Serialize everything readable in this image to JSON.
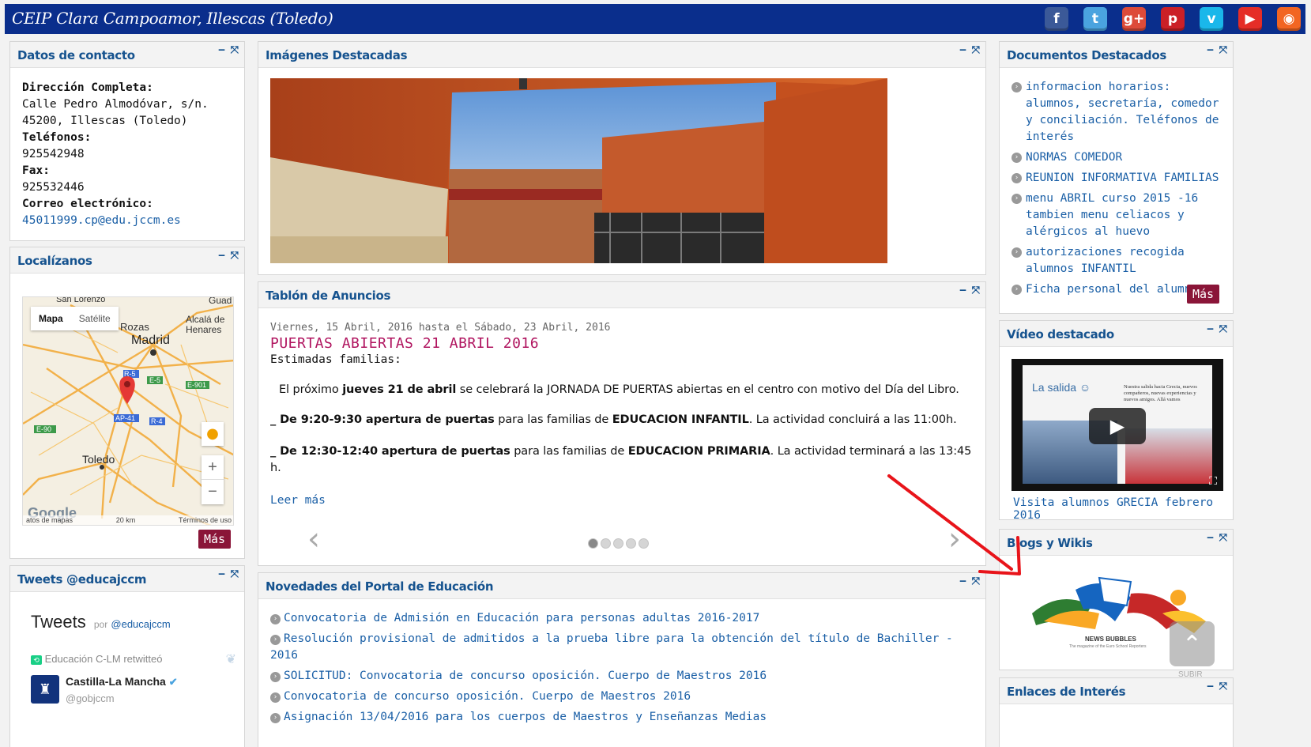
{
  "site_title": "CEIP Clara Campoamor, Illescas (Toledo)",
  "social": [
    {
      "icon": "facebook-icon",
      "glyph": "f",
      "color": "#3b5998"
    },
    {
      "icon": "twitter-icon",
      "glyph": "t",
      "color": "#4aa3df"
    },
    {
      "icon": "googleplus-icon",
      "glyph": "g+",
      "color": "#dd4b39"
    },
    {
      "icon": "pinterest-icon",
      "glyph": "p",
      "color": "#cb2027"
    },
    {
      "icon": "vimeo-icon",
      "glyph": "v",
      "color": "#1ab7ea"
    },
    {
      "icon": "youtube-icon",
      "glyph": "▶",
      "color": "#e52d27"
    },
    {
      "icon": "rss-icon",
      "glyph": "◉",
      "color": "#f26522"
    }
  ],
  "contact": {
    "title": "Datos de contacto",
    "address_label": "Dirección Completa:",
    "address": "Calle Pedro Almodóvar, s/n. 45200, Illescas (Toledo)",
    "phones_label": "Teléfonos:",
    "phone": "925542948",
    "fax_label": "Fax:",
    "fax": "925532446",
    "email_label": "Correo electrónico:",
    "email": "45011999.cp@edu.jccm.es"
  },
  "map": {
    "title": "Localízanos",
    "tab_map": "Mapa",
    "tab_satellite": "Satélite",
    "labels": {
      "madrid": "Madrid",
      "toledo": "Toledo",
      "rozas": "Rozas",
      "alcala": "Alcalá de Henares",
      "sanlorenzo": "San Lorenzo",
      "guad": "Guad"
    },
    "roads": {
      "r5": "R-5",
      "e5": "E-5",
      "e901": "E-901",
      "e90": "E-90",
      "ap41": "AP-41",
      "r4": "R-4"
    },
    "footer_data": "atos de mapas",
    "scale": "20 km",
    "terms": "Términos de uso",
    "google": "Google",
    "zoom_in": "+",
    "zoom_out": "−",
    "more": "Más"
  },
  "tweets": {
    "title": "Tweets @educajccm",
    "heading": "Tweets",
    "by": "por",
    "handle_link": "@educajccm",
    "retweet": "Educación C-LM retwitteó",
    "author": "Castilla-La Mancha",
    "author_handle": "@gobjccm"
  },
  "images": {
    "title": "Imágenes Destacadas"
  },
  "board": {
    "title": "Tablón de Anuncios",
    "date": "Viernes, 15 Abril, 2016 hasta el Sábado, 23 Abril, 2016",
    "headline": "PUERTAS ABIERTAS 21 ABRIL 2016",
    "greeting": "Estimadas familias:",
    "p1_a": "El próximo ",
    "p1_b": "jueves 21 de abril",
    "p1_c": " se celebrará la JORNADA DE PUERTAS abiertas en el centro con motivo del Día del Libro.",
    "p2_a": "_ De 9:20-9:30 apertura de puertas",
    "p2_b": " para las familias de ",
    "p2_c": "EDUCACION INFANTIL",
    "p2_d": ". La actividad concluirá a las 11:00h.",
    "p3_a": "_ De 12:30-12:40 apertura de puertas",
    "p3_b": "  para las familias de ",
    "p3_c": "EDUCACION PRIMARIA",
    "p3_d": ". La actividad terminará a las 13:45 h.",
    "read_more": "Leer más",
    "prev": "‹",
    "next": "›"
  },
  "news": {
    "title": "Novedades del Portal de Educación",
    "items": [
      "Convocatoria de Admisión en Educación para personas adultas 2016-2017",
      "Resolución provisional de admitidos a la prueba libre para la obtención del título de Bachiller - 2016",
      "SOLICITUD: Convocatoria de concurso oposición. Cuerpo de Maestros 2016",
      "Convocatoria de concurso oposición. Cuerpo de Maestros 2016",
      "Asignación 13/04/2016 para los cuerpos de Maestros y Enseñanzas Medias"
    ]
  },
  "docs": {
    "title": "Documentos Destacados",
    "items": [
      "informacion horarios: alumnos, secretaría, comedor y conciliación. Teléfonos de interés",
      "NORMAS COMEDOR",
      "REUNION INFORMATIVA FAMILIAS",
      "menu ABRIL curso 2015 -16 tambien menu celiacos y alérgicos al huevo",
      "autorizaciones recogida alumnos INFANTIL",
      "Ficha personal del alumno"
    ],
    "more": "Más"
  },
  "video": {
    "title": "Vídeo destacado",
    "thumb_title": "La salida ☺",
    "thumb_text": "Nuestra salida hacia Grecia, nuevos compañeros, nuevas experiencias y nuevos amigos. Allá vamos",
    "caption": "Visita alumnos GRECIA febrero 2016"
  },
  "blogs": {
    "title": "Blogs y Wikis",
    "logo_text": "NEWS BUBBLES",
    "logo_sub": "The magazine of the Euro School Reporters",
    "scroll_up": "SUBIR"
  },
  "links": {
    "title": "Enlaces de Interés"
  },
  "colors": {
    "header": "#0a2e8c",
    "panel_title": "#16538f",
    "link": "#1a5fa6",
    "headline": "#b0145f",
    "more_btn": "#8a1538",
    "arrow": "#e8141a"
  }
}
